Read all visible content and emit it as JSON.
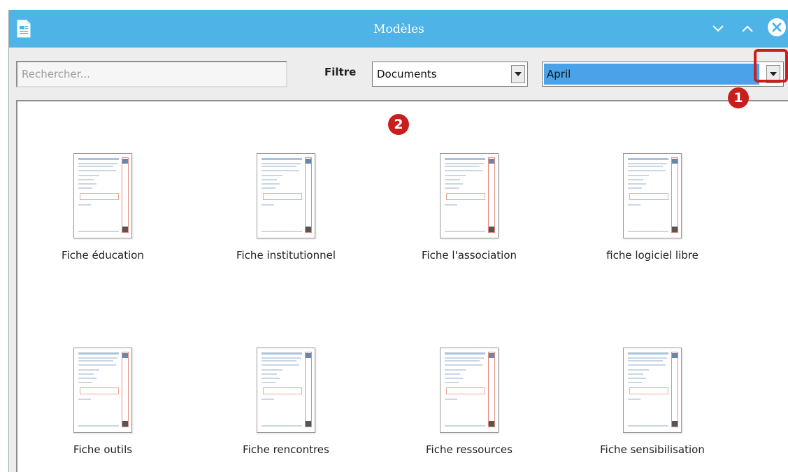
{
  "window": {
    "title": "Modèles"
  },
  "toolbar": {
    "search_placeholder": "Rechercher...",
    "filter_label": "Filtre",
    "filter_value": "Documents",
    "category_value": "April"
  },
  "annotations": {
    "badge_1": "1",
    "badge_2": "2",
    "color": "#c81e1e"
  },
  "templates": [
    {
      "label": "Fiche éducation"
    },
    {
      "label": "Fiche institutionnel"
    },
    {
      "label": "Fiche l'association"
    },
    {
      "label": "fiche logiciel libre"
    },
    {
      "label": "Fiche outils"
    },
    {
      "label": "Fiche rencontres"
    },
    {
      "label": "Fiche ressources"
    },
    {
      "label": "Fiche sensibilisation"
    }
  ],
  "colors": {
    "titlebar": "#4eb3e6",
    "selection": "#4aa3e8"
  },
  "icons": {
    "app": "writer-document-icon",
    "minimize": "chevron-down-icon",
    "maximize": "chevron-up-icon",
    "close": "close-circle-icon"
  }
}
